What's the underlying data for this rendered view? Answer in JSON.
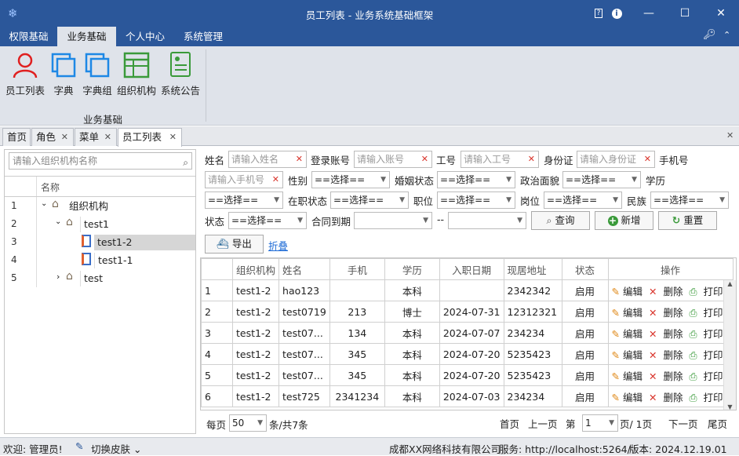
{
  "window": {
    "title": "员工列表 - 业务系统基础框架"
  },
  "menu": [
    "权限基础",
    "业务基础",
    "个人中心",
    "系统管理"
  ],
  "ribbon": {
    "buttons": [
      "员工列表",
      "字典",
      "字典组",
      "组织机构",
      "系统公告"
    ],
    "group": "业务基础"
  },
  "doc_tabs": [
    "首页",
    "角色",
    "菜单",
    "员工列表"
  ],
  "left": {
    "search_placeholder": "请输入组织机构名称",
    "col_header": "名称",
    "tree": [
      {
        "n": "1",
        "label": "组织机构"
      },
      {
        "n": "2",
        "label": "test1"
      },
      {
        "n": "3",
        "label": "test1-2"
      },
      {
        "n": "4",
        "label": "test1-1"
      },
      {
        "n": "5",
        "label": "test"
      }
    ]
  },
  "filters": {
    "name": "姓名",
    "name_ph": "请输入姓名",
    "account": "登录账号",
    "account_ph": "请输入账号",
    "job_no": "工号",
    "job_no_ph": "请输入工号",
    "id_card": "身份证",
    "id_card_ph": "请输入身份证",
    "phone": "手机号",
    "phone_ph": "请输入手机号",
    "gender": "性别",
    "marital": "婚姻状态",
    "political": "政治面貌",
    "education": "学历",
    "employment": "在职状态",
    "title": "职位",
    "post": "岗位",
    "ethnicity": "民族",
    "state": "状态",
    "contract_due": "合同到期",
    "range_sep": "--",
    "select_default": "==选择==",
    "btn_query": "查询",
    "btn_add": "新增",
    "btn_reset": "重置",
    "btn_export": "导出",
    "collapse": "折叠"
  },
  "table": {
    "headers": [
      "组织机构",
      "姓名",
      "手机",
      "学历",
      "入职日期",
      "现居地址",
      "状态",
      "操作"
    ],
    "rows": [
      {
        "n": "1",
        "org": "test1-2",
        "name": "hao123",
        "phone": "",
        "edu": "本科",
        "date": "",
        "addr": "2342342",
        "state": "启用"
      },
      {
        "n": "2",
        "org": "test1-2",
        "name": "test0719",
        "phone": "213",
        "edu": "博士",
        "date": "2024-07-31",
        "addr": "12312321",
        "state": "启用"
      },
      {
        "n": "3",
        "org": "test1-2",
        "name": "test07...",
        "phone": "134",
        "edu": "本科",
        "date": "2024-07-07",
        "addr": "234234",
        "state": "启用"
      },
      {
        "n": "4",
        "org": "test1-2",
        "name": "test07...",
        "phone": "345",
        "edu": "本科",
        "date": "2024-07-20",
        "addr": "5235423",
        "state": "启用"
      },
      {
        "n": "5",
        "org": "test1-2",
        "name": "test07...",
        "phone": "345",
        "edu": "本科",
        "date": "2024-07-20",
        "addr": "5235423",
        "state": "启用"
      },
      {
        "n": "6",
        "org": "test1-2",
        "name": "test725",
        "phone": "2341234",
        "edu": "本科",
        "date": "2024-07-03",
        "addr": "234234",
        "state": "启用"
      }
    ],
    "op_edit": "编辑",
    "op_delete": "删除",
    "op_print": "打印"
  },
  "pager": {
    "per_page_label": "每页",
    "per_page": "50",
    "total": "条/共7条",
    "first": "首页",
    "prev": "上一页",
    "page_label": "第",
    "page": "1",
    "of": "页/ 1页",
    "next": "下一页",
    "last": "尾页"
  },
  "status": {
    "welcome": "欢迎: 管理员!",
    "skin": "切换皮肤",
    "company": "成都XX网络科技有限公司",
    "service": "服务: http://localhost:5264/",
    "version": "版本: 2024.12.19.01"
  },
  "colors": {
    "titlebar": "#2b579a",
    "ribbon": "#dfe3ea",
    "accent": "#1e88e5"
  }
}
